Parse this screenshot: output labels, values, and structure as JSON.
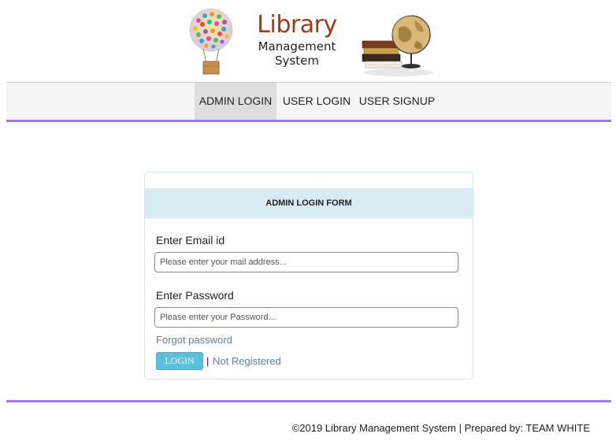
{
  "logo": {
    "title": "Library",
    "subtitle_line1": "Management",
    "subtitle_line2": "System"
  },
  "nav": {
    "items": [
      {
        "label": "ADMIN LOGIN",
        "active": true
      },
      {
        "label": "USER LOGIN",
        "active": false
      },
      {
        "label": "USER SIGNUP",
        "active": false
      }
    ]
  },
  "form": {
    "heading": "ADMIN LOGIN FORM",
    "email_label": "Enter Email id",
    "email_placeholder": "Please enter your mail address...",
    "email_value": "",
    "password_label": "Enter Password",
    "password_placeholder": "Please enter your Password...",
    "password_value": "",
    "forgot_link": "Forgot password",
    "login_button": "LOGIN",
    "separator": "|",
    "register_link": "Not Registered"
  },
  "footer": {
    "text": "©2019 Library Management System | Prepared by: TEAM WHITE"
  },
  "colors": {
    "accent_line": "#9b7fd6",
    "panel_heading_bg": "#d9ecf6",
    "login_button_bg": "#5bc0de",
    "link": "#5f7fa8",
    "logo_title": "#9b3a1a"
  }
}
